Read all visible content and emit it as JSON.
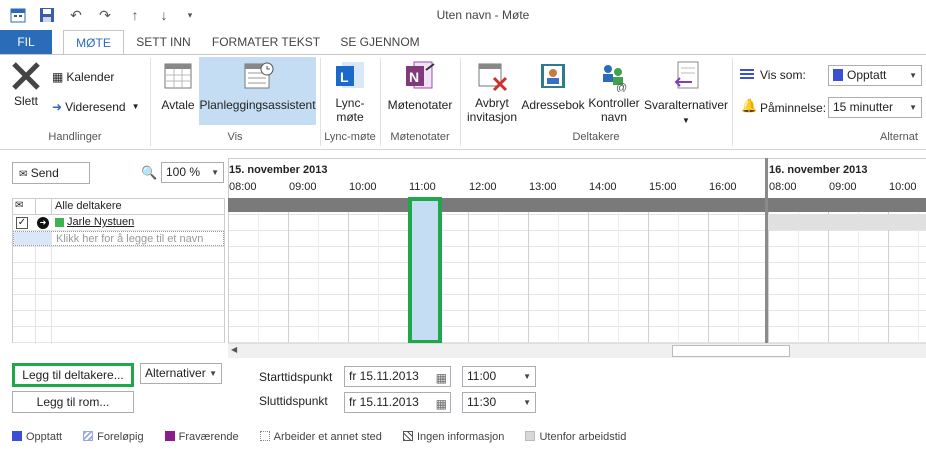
{
  "window": {
    "title": "Uten navn - Møte"
  },
  "tabs": [
    "FIL",
    "MØTE",
    "SETT INN",
    "FORMATER TEKST",
    "SE GJENNOM"
  ],
  "ribbon": {
    "slett": "Slett",
    "kalender": "Kalender",
    "videresend": "Videresend",
    "handlinger": "Handlinger",
    "avtale": "Avtale",
    "planlegging": "Planleggingsassistent",
    "vis": "Vis",
    "lync1": "Lync-",
    "lync2": "møte",
    "lyncgroup": "Lync-møte",
    "motenotater": "Møtenotater",
    "motenotatergroup": "Møtenotater",
    "avbryt1": "Avbryt",
    "avbryt2": "invitasjon",
    "adressebok": "Adressebok",
    "kontroller1": "Kontroller",
    "kontroller2": "navn",
    "svaralt": "Svaralternativer",
    "deltakere": "Deltakere",
    "vissom": "Vis som:",
    "vissom_value": "Opptatt",
    "paaminnelse": "Påminnelse:",
    "paaminnelse_value": "15 minutter",
    "alternativer": "Alternat"
  },
  "scheduler": {
    "send": "Send",
    "zoom": "100 %",
    "date1": "15. november 2013",
    "date2": "16. november 2013",
    "hours1": [
      "08:00",
      "09:00",
      "10:00",
      "11:00",
      "12:00",
      "13:00",
      "14:00",
      "15:00",
      "16:00"
    ],
    "hours2": [
      "08:00",
      "09:00",
      "10:00"
    ],
    "all_attendees": "Alle deltakere",
    "attendee": "Jarle Nystuen",
    "add_placeholder": "Klikk her for å legge til et navn"
  },
  "bottom": {
    "add_attendees": "Legg til deltakere...",
    "add_room": "Legg til rom...",
    "options": "Alternativer",
    "start_label": "Starttidspunkt",
    "end_label": "Sluttidspunkt",
    "start_date": "fr 15.11.2013",
    "end_date": "fr 15.11.2013",
    "start_time": "11:00",
    "end_time": "11:30"
  },
  "legend": [
    {
      "label": "Opptatt",
      "color": "#3a4fd6"
    },
    {
      "label": "Foreløpig",
      "color": "#9aa8e8"
    },
    {
      "label": "Fraværende",
      "color": "#8b1c8b"
    },
    {
      "label": "Arbeider et annet sted",
      "color": "#b0b0b0"
    },
    {
      "label": "Ingen informasjon",
      "color": "#555555"
    },
    {
      "label": "Utenfor arbeidstid",
      "color": "#d8d8d8"
    }
  ]
}
